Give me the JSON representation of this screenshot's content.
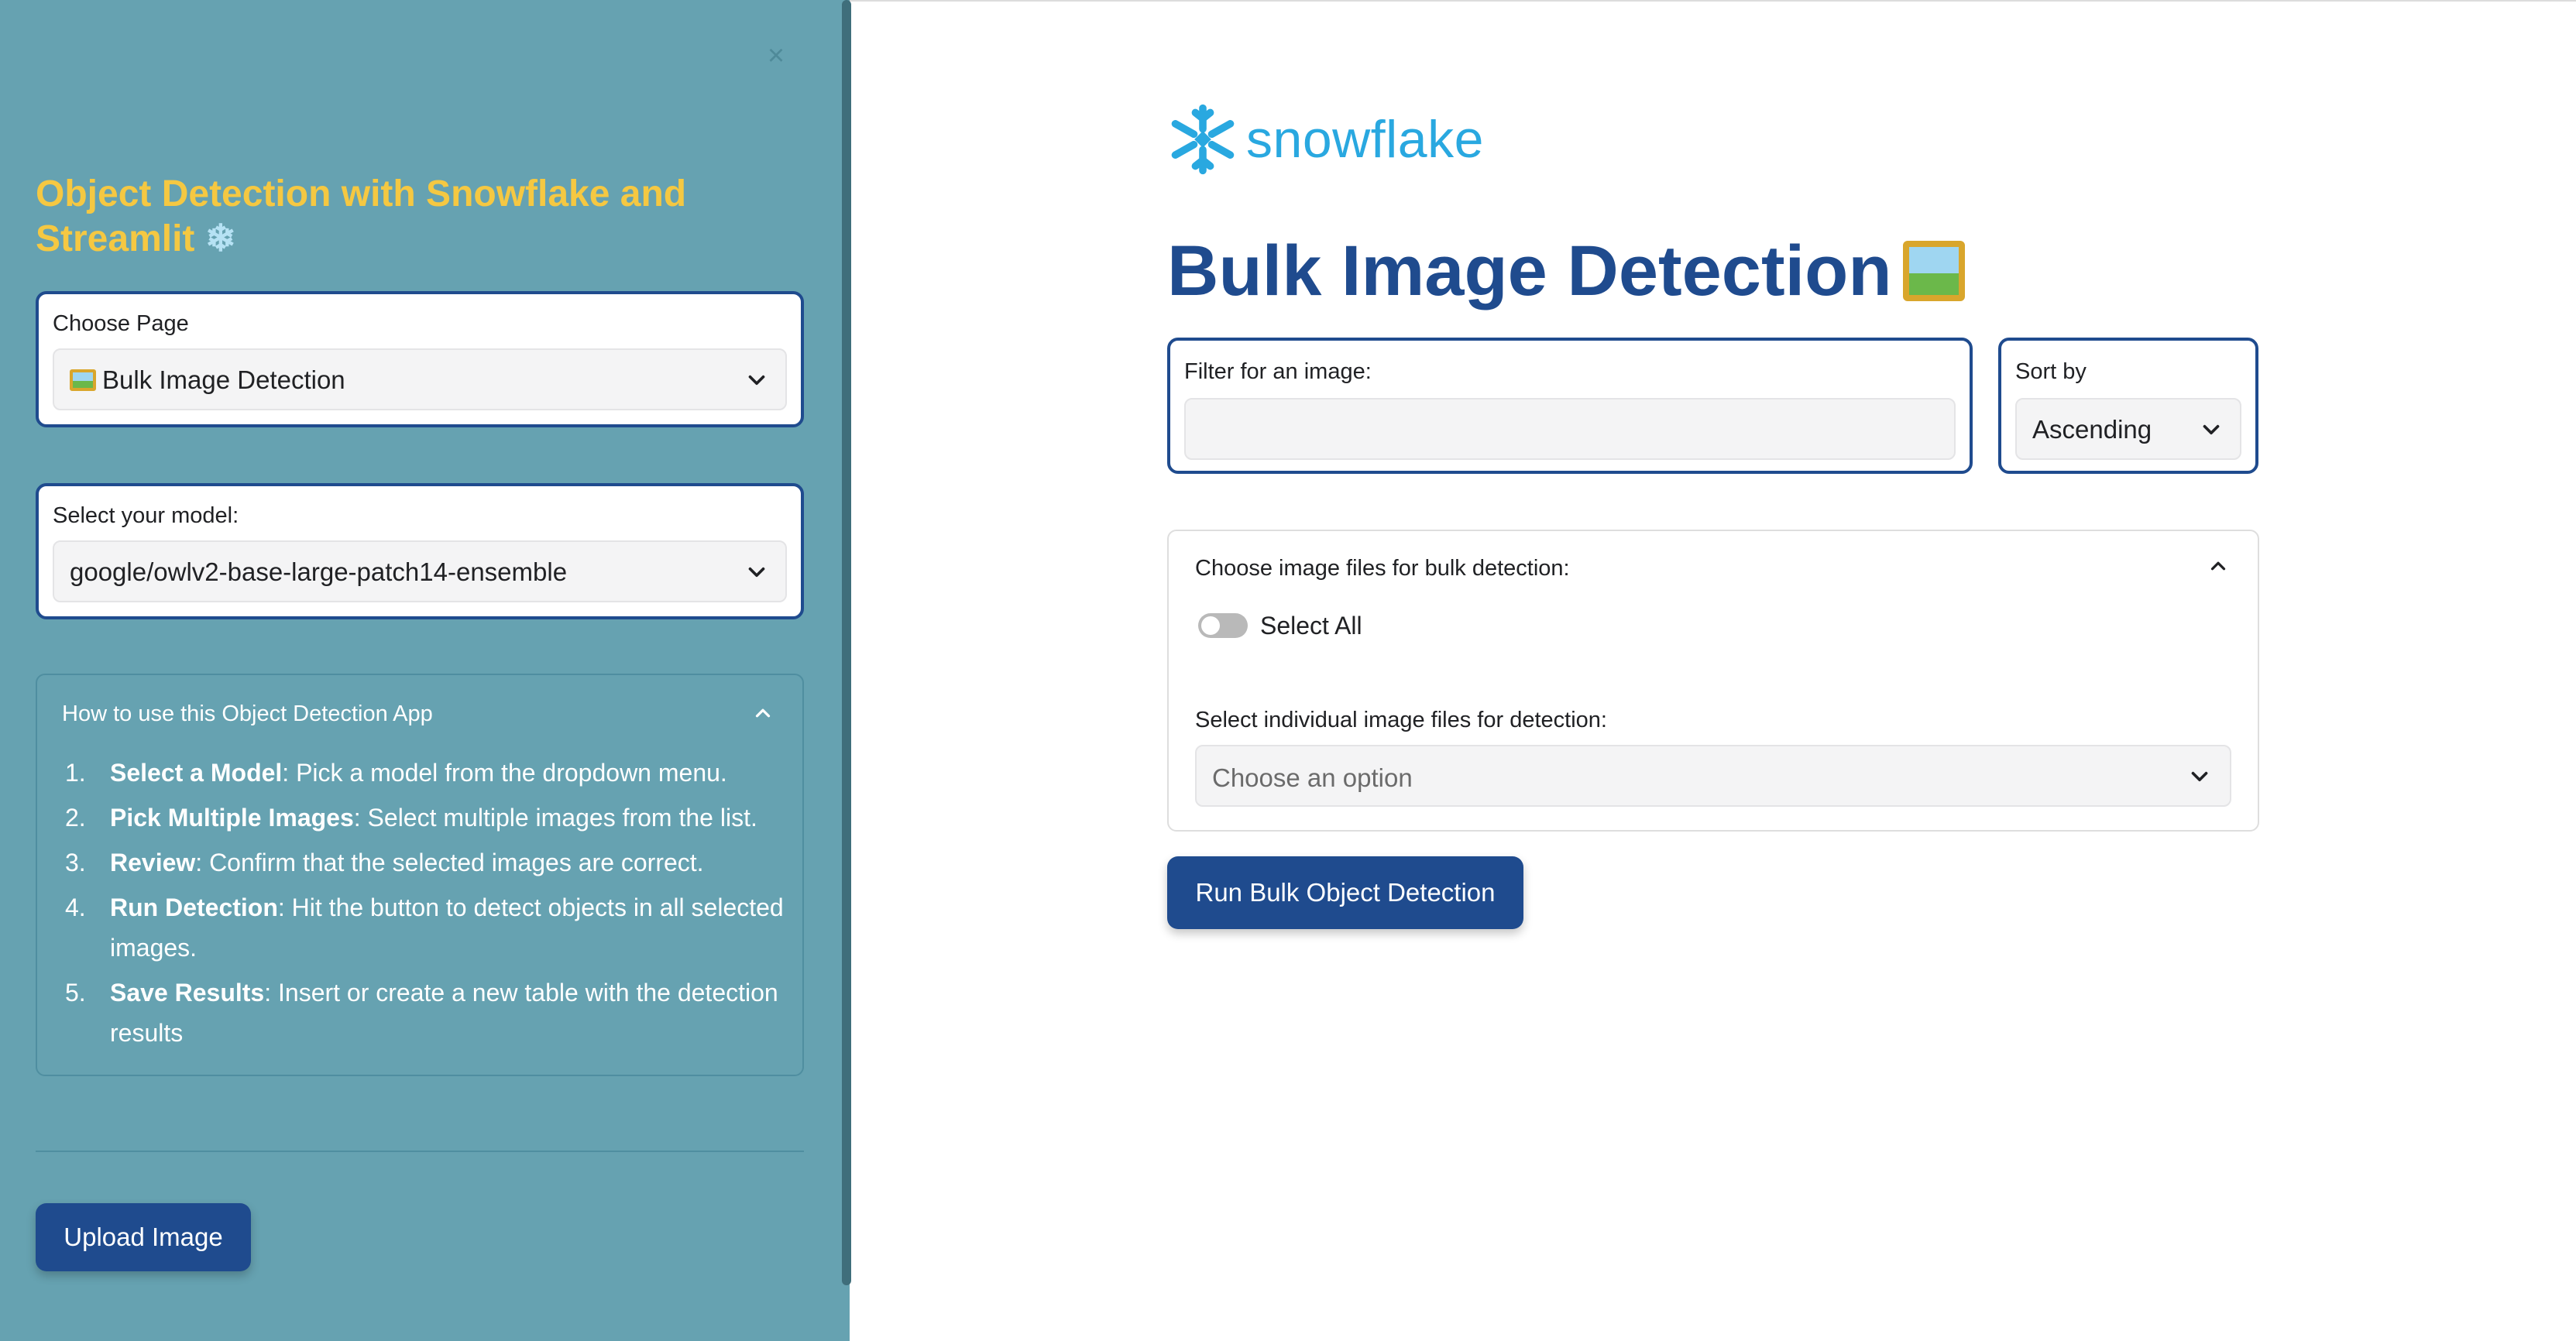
{
  "sidebar": {
    "close_glyph": "×",
    "title": "Object Detection with Snowflake and Streamlit",
    "title_emoji": "❄",
    "choose_page": {
      "label": "Choose Page",
      "value": "Bulk Image Detection"
    },
    "select_model": {
      "label": "Select your model:",
      "value": "google/owlv2-base-large-patch14-ensemble"
    },
    "how_to": {
      "title": "How to use this Object Detection App",
      "steps": [
        {
          "num": "1.",
          "bold": "Select a Model",
          "text": ": Pick a model from the dropdown menu."
        },
        {
          "num": "2.",
          "bold": "Pick Multiple Images",
          "text": ": Select multiple images from the list."
        },
        {
          "num": "3.",
          "bold": "Review",
          "text": ": Confirm that the selected images are correct."
        },
        {
          "num": "4.",
          "bold": "Run Detection",
          "text": ": Hit the button to detect objects in all selected images."
        },
        {
          "num": "5.",
          "bold": "Save Results",
          "text": ": Insert or create a new table with the detection results"
        }
      ]
    },
    "upload_button": "Upload Image"
  },
  "main": {
    "logo_text": "snowflake",
    "page_title": "Bulk Image Detection",
    "filter": {
      "label": "Filter for an image:",
      "value": ""
    },
    "sort": {
      "label": "Sort by",
      "value": "Ascending"
    },
    "expander": {
      "title": "Choose image files for bulk detection:",
      "select_all_label": "Select All",
      "select_all_checked": false,
      "individual_label": "Select individual image files for detection:",
      "individual_placeholder": "Choose an option"
    },
    "run_button": "Run Bulk Object Detection"
  },
  "colors": {
    "sidebar_bg": "#66a2b1",
    "accent_blue": "#1f4b8e",
    "title_yellow": "#f5c842",
    "snowflake_blue": "#29a8e0"
  }
}
